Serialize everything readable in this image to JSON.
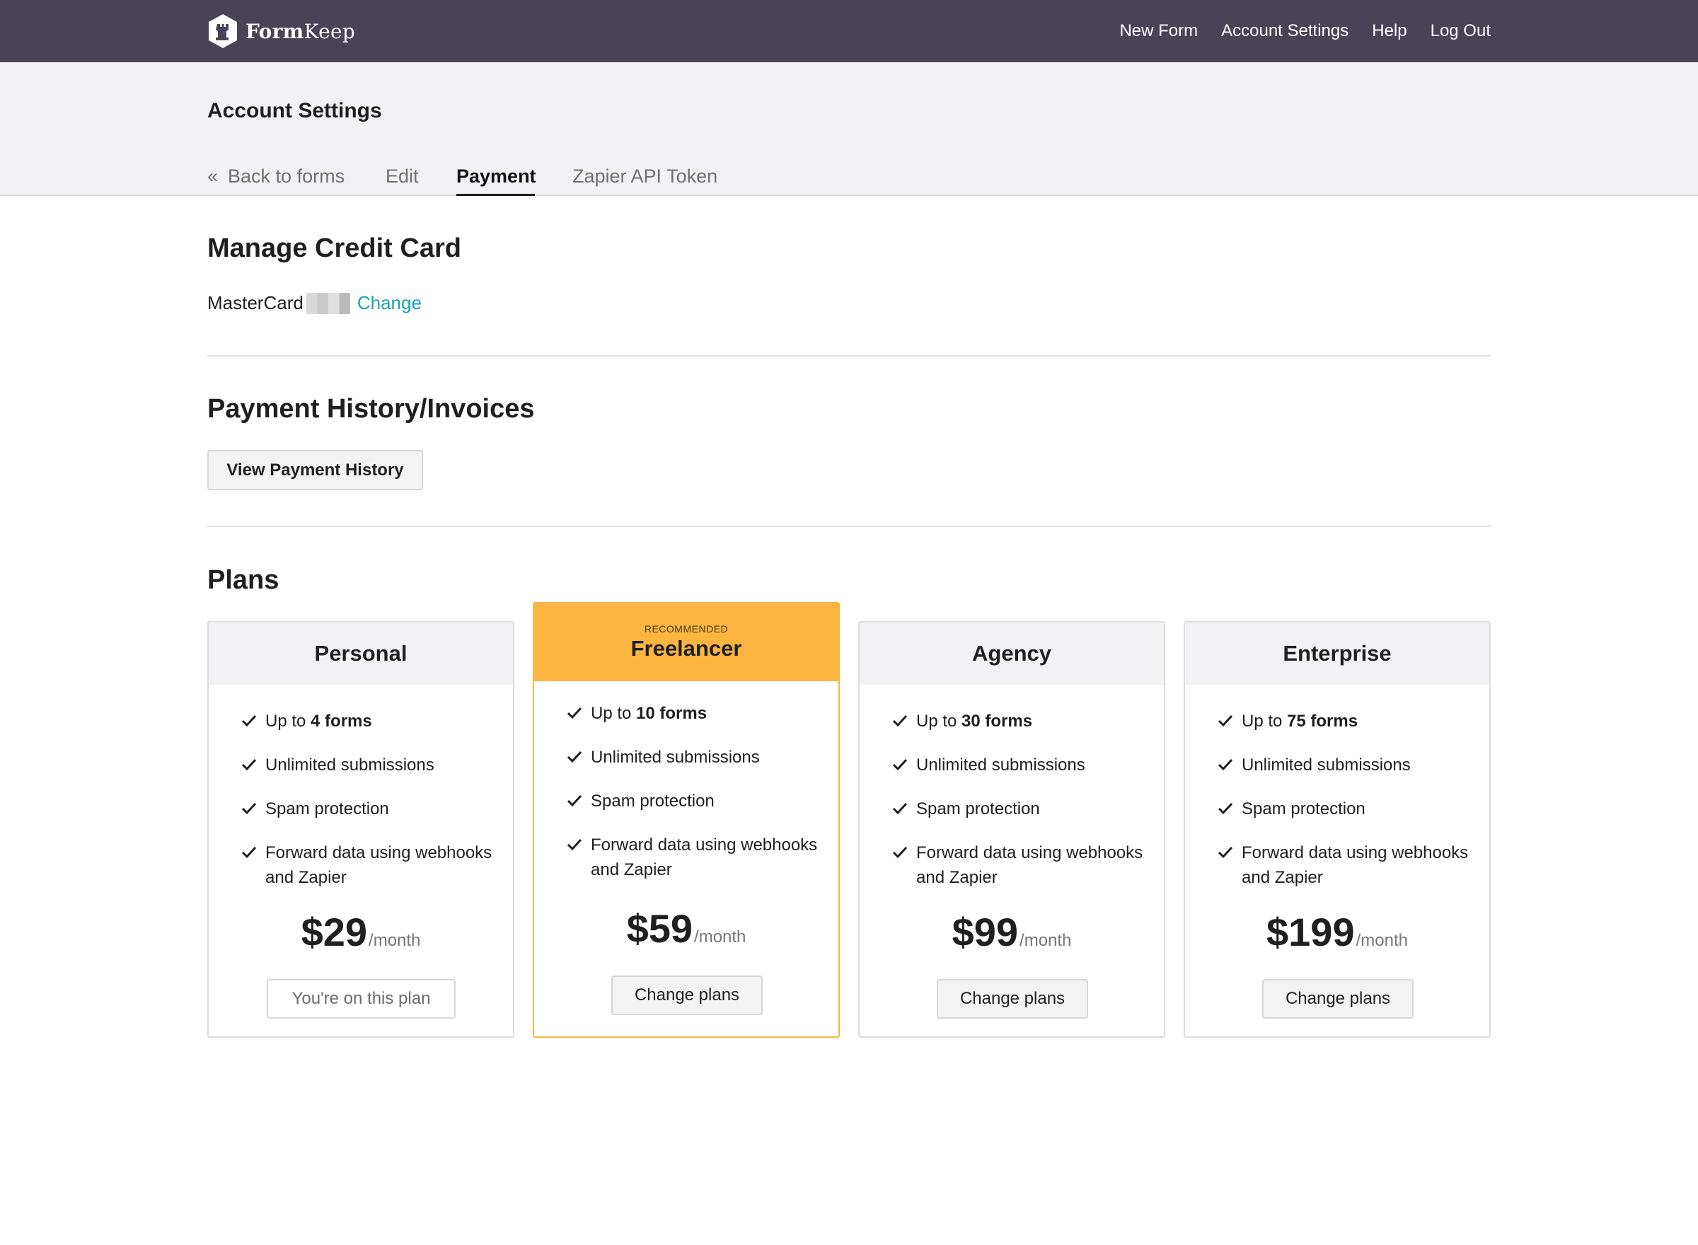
{
  "brand": {
    "name_bold": "Form",
    "name_rest": "Keep"
  },
  "nav": [
    "New Form",
    "Account Settings",
    "Help",
    "Log Out"
  ],
  "page_title": "Account Settings",
  "tabs": {
    "back_glyph": "«",
    "back": "Back to forms",
    "edit": "Edit",
    "payment": "Payment",
    "zapier": "Zapier API Token"
  },
  "credit_card": {
    "title": "Manage Credit Card",
    "brand": "MasterCard",
    "change": "Change"
  },
  "history": {
    "title": "Payment History/Invoices",
    "button": "View Payment History"
  },
  "plans": {
    "title": "Plans",
    "recommended_label": "RECOMMENDED",
    "items": [
      {
        "name": "Personal",
        "forms_prefix": "Up to ",
        "forms_count": "4 forms",
        "f2": "Unlimited submissions",
        "f3": "Spam protection",
        "f4": "Forward data using webhooks and Zapier",
        "price": "$29",
        "per": "/month",
        "button": "You're on this plan"
      },
      {
        "name": "Freelancer",
        "forms_prefix": "Up to ",
        "forms_count": "10 forms",
        "f2": "Unlimited submissions",
        "f3": "Spam protection",
        "f4": "Forward data using webhooks and Zapier",
        "price": "$59",
        "per": "/month",
        "button": "Change plans"
      },
      {
        "name": "Agency",
        "forms_prefix": "Up to ",
        "forms_count": "30 forms",
        "f2": "Unlimited submissions",
        "f3": "Spam protection",
        "f4": "Forward data using webhooks and Zapier",
        "price": "$99",
        "per": "/month",
        "button": "Change plans"
      },
      {
        "name": "Enterprise",
        "forms_prefix": "Up to ",
        "forms_count": "75 forms",
        "f2": "Unlimited submissions",
        "f3": "Spam protection",
        "f4": "Forward data using webhooks and Zapier",
        "price": "$199",
        "per": "/month",
        "button": "Change plans"
      }
    ]
  },
  "colors": {
    "topbar": "#4a4358",
    "accent_link": "#17a2b8",
    "recommended": "#fbb540"
  }
}
